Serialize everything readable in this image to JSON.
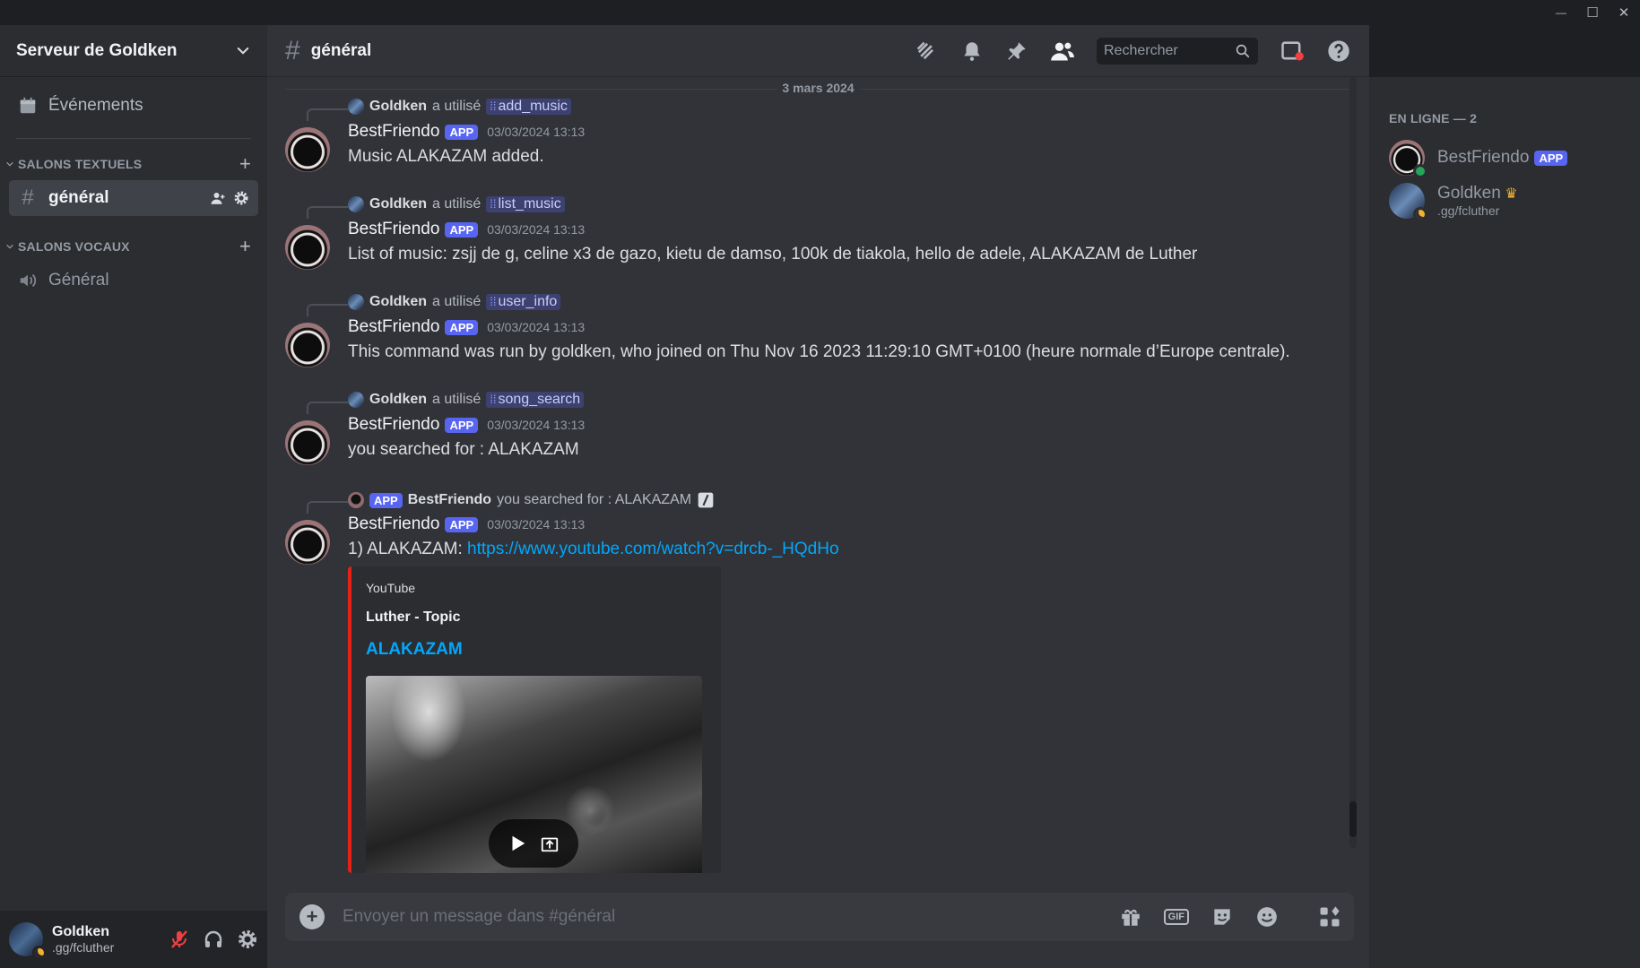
{
  "window": {
    "minimize": "—",
    "maximize": "☐",
    "close": "✕"
  },
  "sidebar": {
    "server_name": "Serveur de Goldken",
    "events_label": "Événements",
    "text_category": "SALONS TEXTUELS",
    "voice_category": "SALONS VOCAUX",
    "text_channels": [
      {
        "label": "général"
      }
    ],
    "voice_channels": [
      {
        "label": "Général"
      }
    ]
  },
  "user_panel": {
    "name": "Goldken",
    "sub": ".gg/fcluther"
  },
  "header": {
    "channel": "général",
    "search_placeholder": "Rechercher"
  },
  "chat": {
    "date_divider": "3 mars 2024",
    "used_text": "a utilisé",
    "messages": [
      {
        "reply_user": "Goldken",
        "command": "add_music",
        "author": "BestFriendo",
        "tag": "APP",
        "time": "03/03/2024 13:13",
        "text": "Music ALAKAZAM added."
      },
      {
        "reply_user": "Goldken",
        "command": "list_music",
        "author": "BestFriendo",
        "tag": "APP",
        "time": "03/03/2024 13:13",
        "text": "List of music: zsjj de g, celine x3 de gazo, kietu de damso, 100k de tiakola, hello de adele, ALAKAZAM de Luther"
      },
      {
        "reply_user": "Goldken",
        "command": "user_info",
        "author": "BestFriendo",
        "tag": "APP",
        "time": "03/03/2024 13:13",
        "text": "This command was run by goldken, who joined on Thu Nov 16 2023 11:29:10 GMT+0100 (heure normale d’Europe centrale)."
      },
      {
        "reply_user": "Goldken",
        "command": "song_search",
        "author": "BestFriendo",
        "tag": "APP",
        "time": "03/03/2024 13:13",
        "text": "you searched for : ALAKAZAM"
      },
      {
        "reply_tag": "APP",
        "reply_user": "BestFriendo",
        "reply_text": "you searched for : ALAKAZAM",
        "author": "BestFriendo",
        "tag": "APP",
        "time": "03/03/2024 13:13",
        "text_prefix": "1) ALAKAZAM: ",
        "link": "https://www.youtube.com/watch?v=drcb-_HQdHo",
        "embed": {
          "provider": "YouTube",
          "author": "Luther - Topic",
          "title": "ALAKAZAM",
          "accent": "#e62117"
        }
      }
    ]
  },
  "composer": {
    "placeholder": "Envoyer un message dans #général",
    "gif_label": "GIF"
  },
  "members": {
    "category": "EN LIGNE — 2",
    "list": [
      {
        "name": "BestFriendo",
        "tag": "APP",
        "status": "online"
      },
      {
        "name": "Goldken",
        "sub": ".gg/fcluther",
        "status": "idle",
        "owner": true
      }
    ]
  },
  "colors": {
    "brand": "#5865f2",
    "link": "#00a8fc",
    "online": "#23a55a",
    "idle": "#f0b232",
    "bg_main": "#313338",
    "bg_sidebar": "#2b2d31"
  }
}
